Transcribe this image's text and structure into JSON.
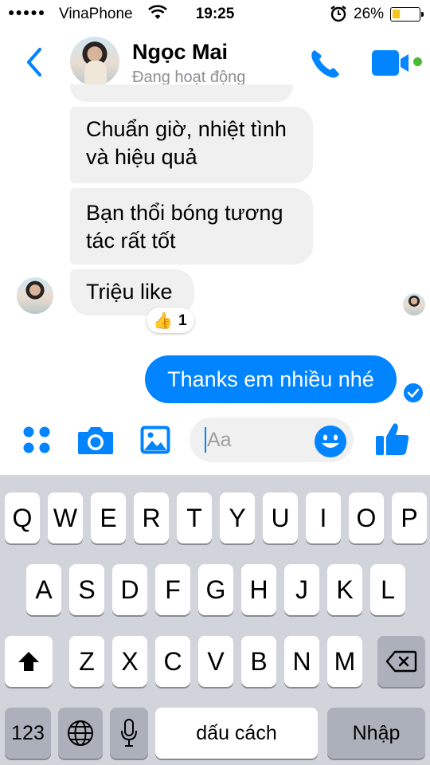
{
  "status_bar": {
    "signal": "●●●●●",
    "carrier": "VinaPhone",
    "time": "19:25",
    "battery_percent": "26%",
    "battery_level": 0.26
  },
  "header": {
    "contact_name": "Ngọc Mai",
    "presence": "Đang hoạt động",
    "accent_color": "#0084ff",
    "online_color": "#44bd32"
  },
  "messages": [
    {
      "from": "contact",
      "text": ""
    },
    {
      "from": "contact",
      "text": [
        "Chuẩn giờ, nhiệt tình",
        "và hiệu quả"
      ]
    },
    {
      "from": "contact",
      "text": [
        "Bạn thổi bóng tương",
        "tác rất tốt"
      ]
    },
    {
      "from": "contact",
      "text": [
        "Triệu like"
      ],
      "reaction": {
        "emoji": "👍",
        "count": "1"
      }
    },
    {
      "from": "me",
      "text": [
        "Thanks em nhiều nhé"
      ]
    }
  ],
  "composer": {
    "placeholder": "Aa",
    "icons": [
      "more-apps-icon",
      "camera-icon",
      "gallery-icon",
      "emoji-icon",
      "thumbs-up-icon"
    ]
  },
  "keyboard": {
    "row1": [
      "Q",
      "W",
      "E",
      "R",
      "T",
      "Y",
      "U",
      "I",
      "O",
      "P"
    ],
    "row2": [
      "A",
      "S",
      "D",
      "F",
      "G",
      "H",
      "J",
      "K",
      "L"
    ],
    "row3": [
      "Z",
      "X",
      "C",
      "V",
      "B",
      "N",
      "M"
    ],
    "numbers_key": "123",
    "space_key": "dấu cách",
    "return_key": "Nhập"
  }
}
